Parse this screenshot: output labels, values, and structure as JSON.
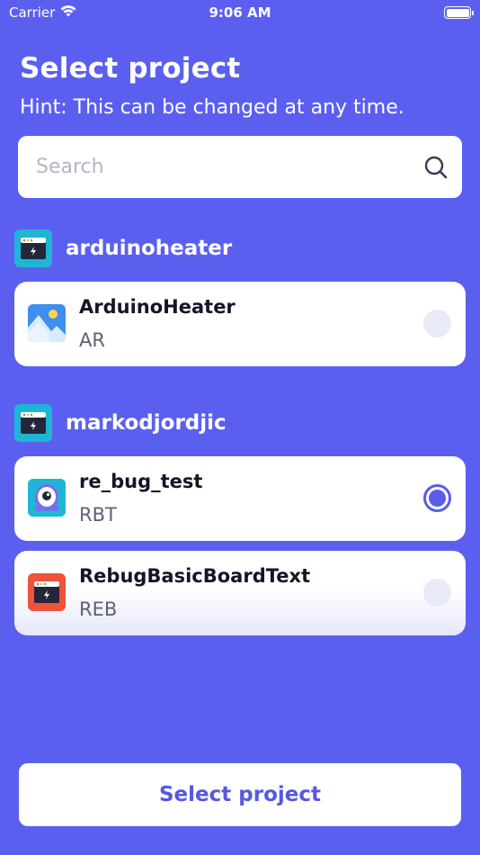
{
  "status_bar": {
    "carrier": "Carrier",
    "time": "9:06 AM"
  },
  "header": {
    "title": "Select project",
    "hint": "Hint: This can be changed at any time."
  },
  "search": {
    "placeholder": "Search"
  },
  "groups": [
    {
      "name": "arduinoheater",
      "icon": "app-window-icon",
      "projects": [
        {
          "name": "ArduinoHeater",
          "code": "AR",
          "icon": "mountain-image-icon",
          "selected": false
        }
      ]
    },
    {
      "name": "markodjordjic",
      "icon": "app-window-icon",
      "projects": [
        {
          "name": "re_bug_test",
          "code": "RBT",
          "icon": "robot-icon",
          "selected": true
        },
        {
          "name": "RebugBasicBoardText",
          "code": "REB",
          "icon": "app-window-icon",
          "selected": false
        }
      ]
    }
  ],
  "footer": {
    "button_label": "Select project"
  },
  "colors": {
    "background": "#5b5ff0",
    "accent": "#5a5ce8",
    "icon_teal": "#1fb6d6",
    "icon_orange": "#f0523a"
  }
}
